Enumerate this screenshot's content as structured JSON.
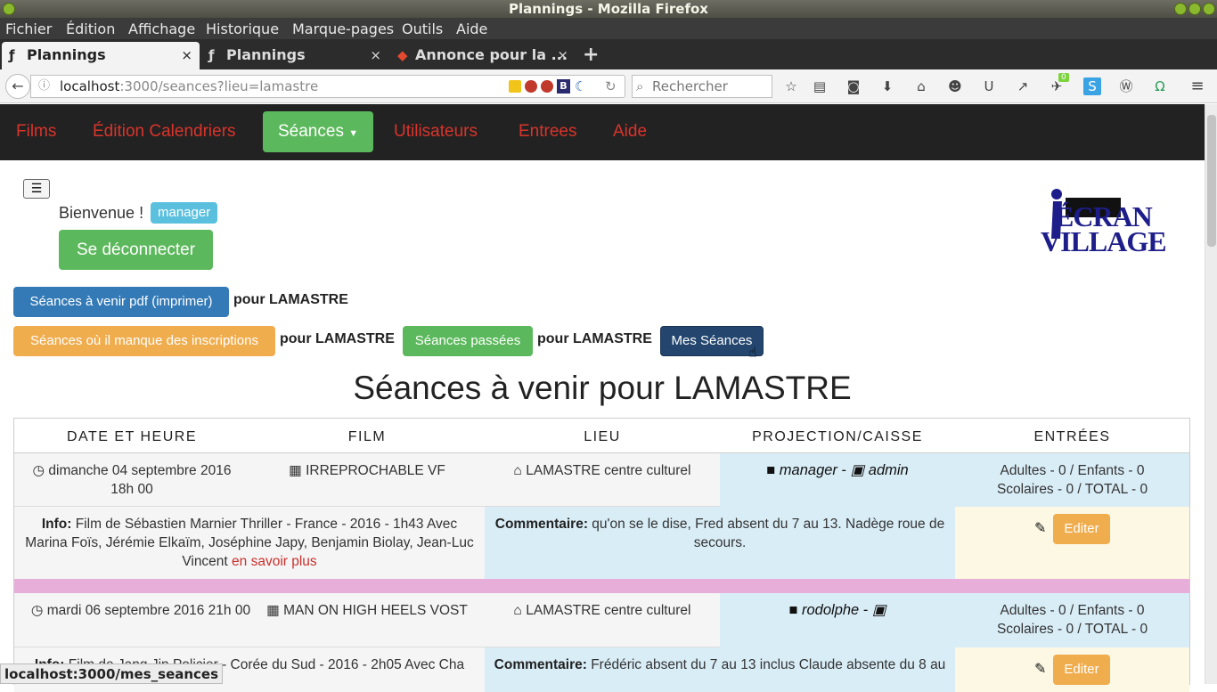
{
  "window": {
    "title": "Plannings - Mozilla Firefox"
  },
  "menu": [
    "Fichier",
    "Édition",
    "Affichage",
    "Historique",
    "Marque-pages",
    "Outils",
    "Aide"
  ],
  "tabs": [
    {
      "label": "Plannings",
      "close": "×"
    },
    {
      "label": "Plannings",
      "close": "×"
    },
    {
      "label": "Annonce pour la ...",
      "close": "×"
    }
  ],
  "new_tab": "+",
  "url": {
    "host": "localhost",
    "rest": ":3000/seances?lieu=lamastre"
  },
  "search": {
    "placeholder": "Rechercher"
  },
  "badge_count": "0",
  "site_nav": {
    "films": "Films",
    "calendriers": "Édition Calendriers",
    "seances": "Séances",
    "utilisateurs": "Utilisateurs",
    "entrees": "Entrees",
    "aide": "Aide"
  },
  "toggle": "☰",
  "welcome": {
    "text": "Bienvenue !",
    "role": "manager"
  },
  "logout": "Se déconnecter",
  "logo": {
    "line1": "ÉCRAN",
    "line2": "VILLAGE"
  },
  "actions": {
    "pdf": "Séances à venir pdf (imprimer)",
    "pour1": "pour LAMASTRE",
    "missing": "Séances où il manque des inscriptions",
    "pour2": "pour LAMASTRE",
    "past": "Séances passées",
    "pour3": "pour LAMASTRE",
    "mine": "Mes Séances"
  },
  "heading": "Séances à venir pour LAMASTRE",
  "table": {
    "headers": [
      "DATE ET HEURE",
      "FILM",
      "LIEU",
      "PROJECTION/CAISSE",
      "ENTRÉES"
    ],
    "rows": [
      {
        "date": "dimanche 04 septembre 2016",
        "time": "18h 00",
        "film": "IRREPROCHABLE VF",
        "lieu": "LAMASTRE centre culturel",
        "projection": "manager",
        "sep": "-",
        "caisse": "admin",
        "entrees1": "Adultes - 0 / Enfants - 0",
        "entrees2": "Scolaires - 0 / TOTAL - 0",
        "info_label": "Info:",
        "info": "Film de Sébastien Marnier Thriller - France - 2016 - 1h43 Avec Marina Foïs, Jérémie Elkaïm, Joséphine Japy, Benjamin Biolay, Jean-Luc Vincent",
        "info_link": "en savoir plus",
        "comment_label": "Commentaire:",
        "comment": "qu'on se le dise, Fred absent du 7 au 13. Nadège roue de secours.",
        "edit": "Editer"
      },
      {
        "date": "mardi 06 septembre 2016 21h 00",
        "film": "MAN ON HIGH HEELS VOST",
        "lieu": "LAMASTRE centre culturel",
        "projection": "rodolphe",
        "sep": "-",
        "entrees1": "Adultes - 0 / Enfants - 0",
        "entrees2": "Scolaires - 0 / TOTAL - 0",
        "info_label": "Info:",
        "info": "Film de Jang Jin Policier - Corée du Sud - 2016 - 2h05 Avec Cha",
        "comment_label": "Commentaire:",
        "comment": "Frédéric absent du 7 au 13 inclus Claude absente du 8 au",
        "edit": "Editer"
      }
    ]
  },
  "status_url": "localhost:3000/mes_seances",
  "colors": {
    "green": "#5cb85c",
    "blue": "#337ab7",
    "orange": "#f0ad4e",
    "navy": "#23456e",
    "red": "#d9342b",
    "pink": "#e6aed9"
  }
}
